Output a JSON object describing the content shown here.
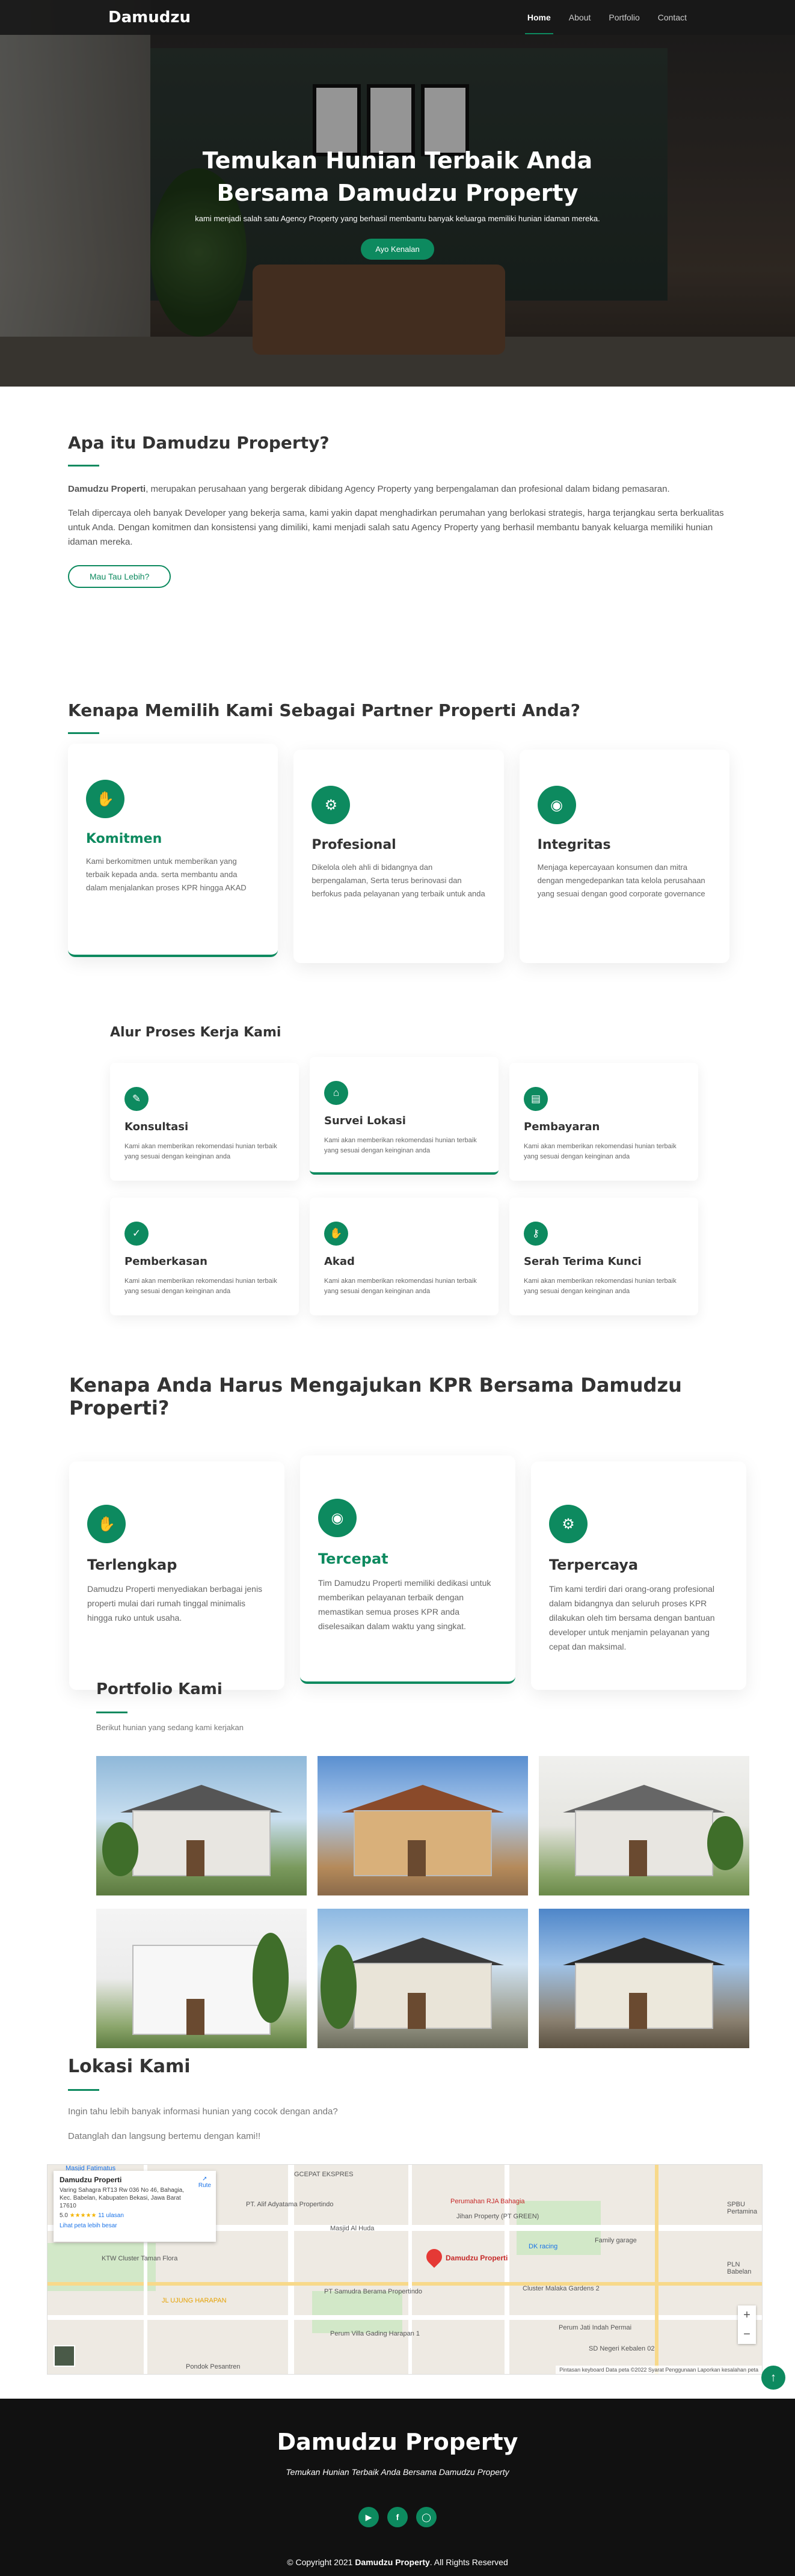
{
  "nav": {
    "brand": "Damudzu",
    "items": [
      {
        "label": "Home",
        "active": true
      },
      {
        "label": "About",
        "active": false
      },
      {
        "label": "Portfolio",
        "active": false
      },
      {
        "label": "Contact",
        "active": false
      }
    ]
  },
  "hero": {
    "title_line1": "Temukan Hunian Terbaik Anda",
    "title_line2": "Bersama Damudzu Property",
    "subtitle": "kami menjadi salah satu Agency Property yang berhasil membantu banyak keluarga memiliki hunian idaman mereka.",
    "cta": "Ayo Kenalan"
  },
  "about": {
    "title": "Apa itu Damudzu Property?",
    "p1_bold": "Damudzu Properti",
    "p1_rest": ", merupakan perusahaan yang bergerak dibidang Agency Property yang berpengalaman dan profesional dalam bidang pemasaran.",
    "p2": "Telah dipercaya oleh banyak Developer yang bekerja sama, kami yakin dapat menghadirkan perumahan yang berlokasi strategis, harga terjangkau serta berkualitas untuk Anda. Dengan komitmen dan konsistensi yang dimiliki, kami menjadi salah satu Agency Property yang berhasil membantu banyak keluarga memiliki hunian idaman mereka.",
    "button": "Mau Tau Lebih?"
  },
  "why": {
    "title": "Kenapa Memilih Kami Sebagai Partner Properti Anda?",
    "cards": [
      {
        "icon": "handshake-icon",
        "title": "Komitmen",
        "text": "Kami berkomitmen untuk memberikan yang terbaik kepada anda. serta membantu anda dalam menjalankan proses KPR hingga AKAD",
        "featured": true
      },
      {
        "icon": "user-gear-icon",
        "title": "Profesional",
        "text": "Dikelola oleh ahli di bidangnya dan berpengalaman, Serta terus berinovasi dan berfokus pada pelayanan yang terbaik untuk anda",
        "featured": false
      },
      {
        "icon": "gauge-icon",
        "title": "Integritas",
        "text": "Menjaga kepercayaan konsumen dan mitra dengan mengedepankan tata kelola perusahaan yang sesuai dengan good corporate governance",
        "featured": false
      }
    ]
  },
  "process": {
    "title": "Alur Proses Kerja Kami",
    "steps": [
      {
        "icon": "clipboard-icon",
        "title": "Konsultasi",
        "text": "Kami akan memberikan rekomendasi hunian terbaik yang sesuai dengan keinginan anda",
        "featured": false
      },
      {
        "icon": "home-icon",
        "title": "Survei Lokasi",
        "text": "Kami akan memberikan rekomendasi hunian terbaik yang sesuai dengan keinginan anda",
        "featured": true
      },
      {
        "icon": "card-icon",
        "title": "Pembayaran",
        "text": "Kami akan memberikan rekomendasi hunian terbaik yang sesuai dengan keinginan anda",
        "featured": false
      },
      {
        "icon": "checklist-icon",
        "title": "Pemberkasan",
        "text": "Kami akan memberikan rekomendasi hunian terbaik yang sesuai dengan keinginan anda",
        "featured": false
      },
      {
        "icon": "handshake-icon",
        "title": "Akad",
        "text": "Kami akan memberikan rekomendasi hunian terbaik yang sesuai dengan keinginan anda",
        "featured": false
      },
      {
        "icon": "key-icon",
        "title": "Serah Terima Kunci",
        "text": "Kami akan memberikan rekomendasi hunian terbaik yang sesuai dengan keinginan anda",
        "featured": false
      }
    ]
  },
  "kpr": {
    "title": "Kenapa Anda Harus Mengajukan KPR Bersama Damudzu Properti?",
    "cards": [
      {
        "icon": "handshake-icon",
        "title": "Terlengkap",
        "text": "Damudzu Properti menyediakan berbagai jenis properti mulai dari rumah tinggal minimalis hingga ruko untuk usaha.",
        "featured": false
      },
      {
        "icon": "gauge-icon",
        "title": "Tercepat",
        "text": "Tim Damudzu Properti memiliki dedikasi untuk memberikan pelayanan terbaik dengan memastikan semua proses KPR anda diselesaikan dalam waktu yang singkat.",
        "featured": true
      },
      {
        "icon": "user-gear-icon",
        "title": "Terpercaya",
        "text": "Tim kami terdiri dari orang-orang profesional dalam bidangnya dan seluruh proses KPR dilakukan oleh tim bersama dengan bantuan developer untuk menjamin pelayanan yang cepat dan maksimal.",
        "featured": false
      }
    ]
  },
  "portfolio": {
    "title": "Portfolio Kami",
    "subtitle": "Berikut hunian yang sedang kami kerjakan"
  },
  "location": {
    "title": "Lokasi Kami",
    "p1": "Ingin tahu lebih banyak informasi hunian yang cocok dengan anda?",
    "p2": "Datanglah dan langsung bertemu dengan kami!!",
    "map": {
      "place_name": "Damudzu Properti",
      "address": "Varing Sahagra RT13 Rw 036 No 46, Bahagia, Kec. Babelan, Kabupaten Bekasi, Jawa Barat 17610",
      "rating": "5.0",
      "stars": "★★★★★",
      "reviews": "11 ulasan",
      "larger_map": "Lihat peta lebih besar",
      "route": "Rute",
      "pin_label": "Damudzu Properti",
      "labels": [
        "Masjid Fatimatus",
        "PT. Alif Adyatama Propertindo",
        "Perumahan RJA Bahagia",
        "Masjid Al Huda",
        "Jihan Property (PT GREEN)",
        "DK racing",
        "Family garage",
        "KTW Cluster Taman Flora",
        "JL UJUNG HARAPAN",
        "PT Samudra Berama Propertindo",
        "Cluster Malaka Gardens 2",
        "Perum Jati Indah Permai",
        "SD Negeri Kebalen 02",
        "Perum Villa Gading Harapan 1",
        "Pondok Pesantren",
        "SPBU Pertamina",
        "PLN Babelan",
        "GCEPAT EKSPRES"
      ],
      "footer": "Pintasan keyboard   Data peta ©2022   Syarat Penggunaan   Laporkan kesalahan peta"
    }
  },
  "footer": {
    "brand": "Damudzu Property",
    "tagline": "Temukan Hunian Terbaik Anda Bersama Damudzu Property",
    "socials": [
      "youtube-icon",
      "facebook-icon",
      "instagram-icon"
    ],
    "copy_pre": "© Copyright 2021 ",
    "copy_brand": "Damudzu Property",
    "copy_post": ". All Rights Reserved"
  }
}
